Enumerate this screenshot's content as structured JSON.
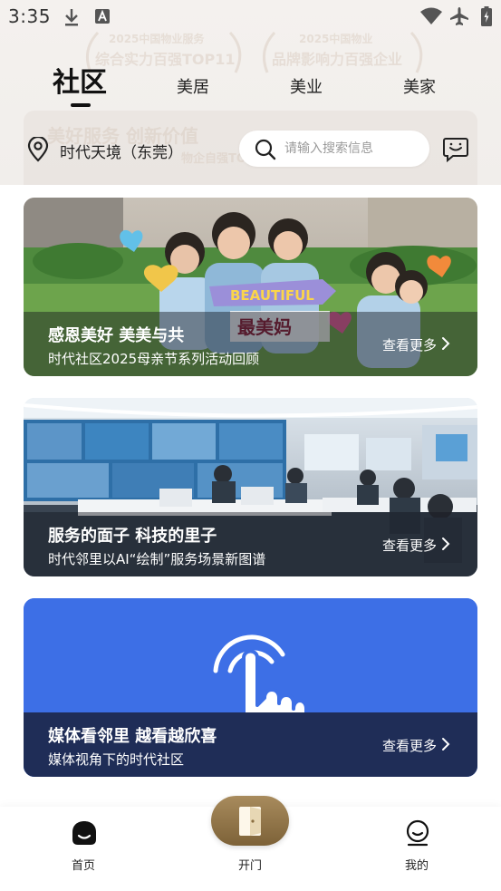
{
  "status_bar": {
    "time": "3:35"
  },
  "header": {
    "deco_texts": [
      "2025中国物业服务",
      "综合实力百强TOP11",
      "2025中国物业",
      "品牌影响力百强企业",
      "美好服务 创新价值",
      "物企自强TOP"
    ],
    "tabs": [
      {
        "label": "社区",
        "active": true
      },
      {
        "label": "美居",
        "active": false
      },
      {
        "label": "美业",
        "active": false
      },
      {
        "label": "美家",
        "active": false
      }
    ],
    "location": "时代天境（东莞）",
    "search": {
      "placeholder": "请输入搜索信息"
    }
  },
  "cards": [
    {
      "title": "感恩美好  美美与共",
      "subtitle": "时代社区2025母亲节系列活动回顾",
      "more_label": "查看更多",
      "banner_text": "BEAUTIFUL",
      "banner_cn": "最美妈"
    },
    {
      "title": "服务的面子  科技的里子",
      "subtitle": "时代邻里以AI“绘制”服务场景新图谱",
      "more_label": "查看更多"
    },
    {
      "title": "媒体看邻里  越看越欣喜",
      "subtitle": "媒体视角下的时代社区",
      "more_label": "查看更多"
    }
  ],
  "bottom_nav": {
    "home": "首页",
    "door": "开门",
    "mine": "我的"
  },
  "colors": {
    "accent_gold": "#9a7d4f",
    "card3_blue": "#3d6fe6",
    "header_bg": "#f3f0ed"
  }
}
